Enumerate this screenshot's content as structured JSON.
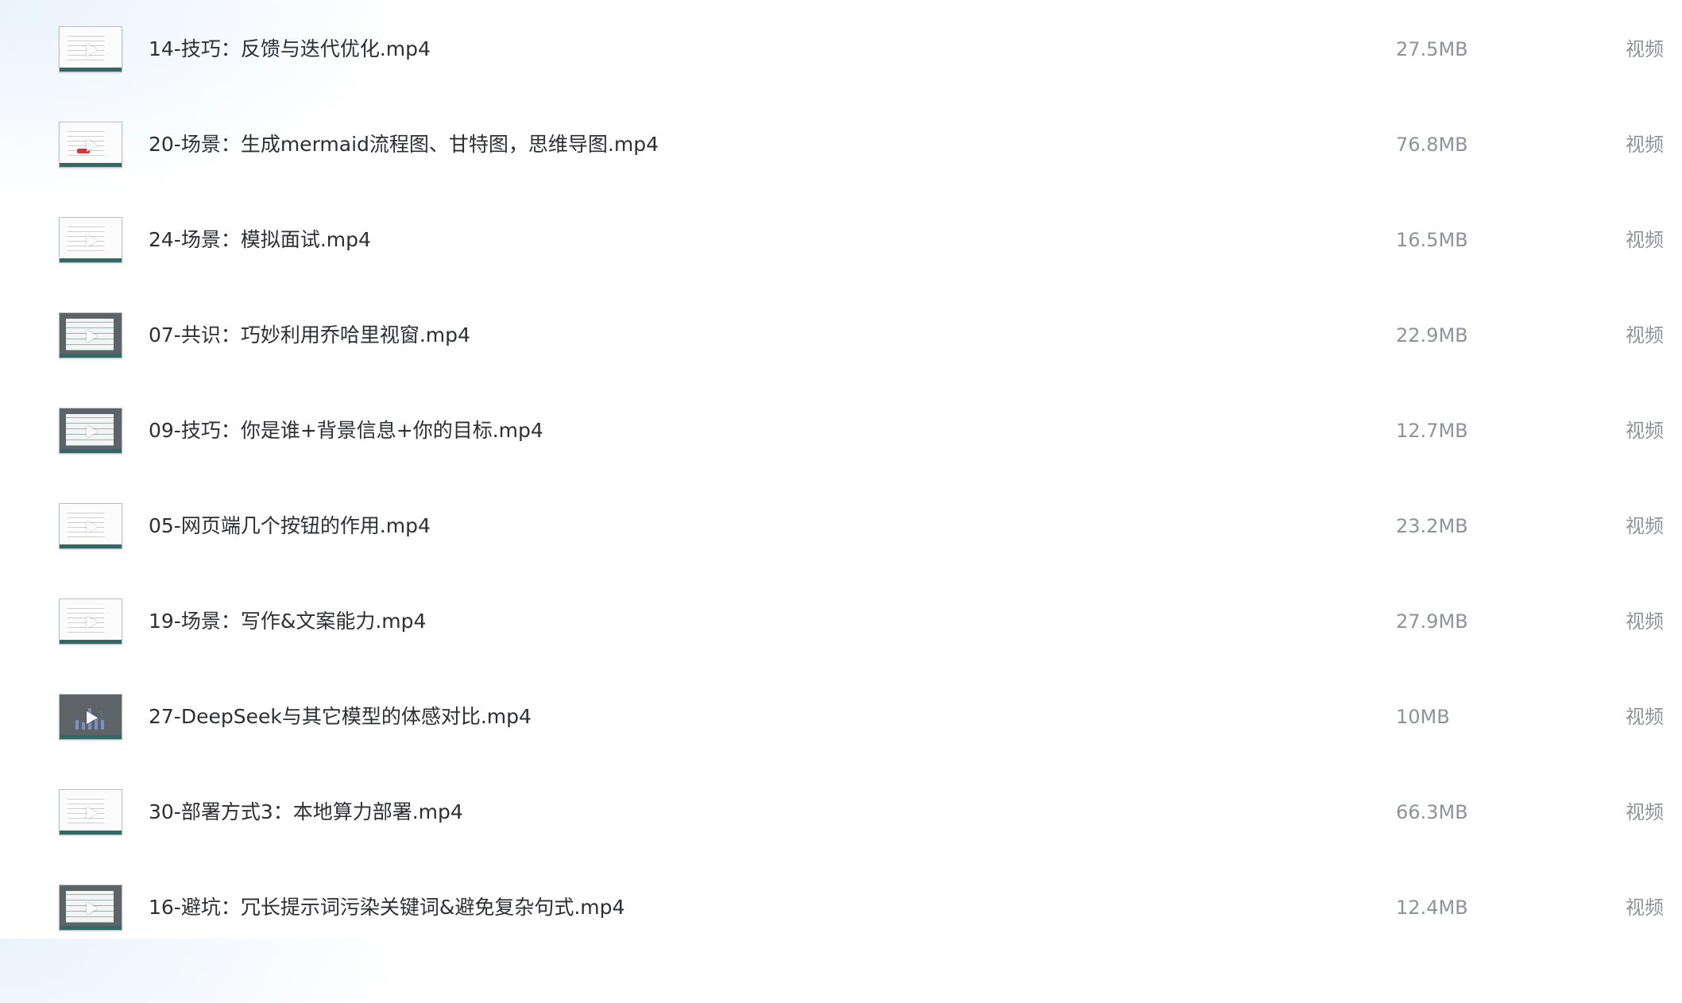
{
  "files": [
    {
      "name": "14-技巧：反馈与迭代优化.mp4",
      "size": "27.5MB",
      "type": "视频",
      "thumbnail": "document-video-thumbnail"
    },
    {
      "name": "20-场景：生成mermaid流程图、甘特图，思维导图.mp4",
      "size": "76.8MB",
      "type": "视频",
      "thumbnail": "diagram-video-thumbnail"
    },
    {
      "name": "24-场景：模拟面试.mp4",
      "size": "16.5MB",
      "type": "视频",
      "thumbnail": "document-video-thumbnail"
    },
    {
      "name": "07-共识：巧妙利用乔哈里视窗.mp4",
      "size": "22.9MB",
      "type": "视频",
      "thumbnail": "slide-video-thumbnail"
    },
    {
      "name": "09-技巧：你是谁+背景信息+你的目标.mp4",
      "size": "12.7MB",
      "type": "视频",
      "thumbnail": "slide-video-thumbnail"
    },
    {
      "name": "05-网页端几个按钮的作用.mp4",
      "size": "23.2MB",
      "type": "视频",
      "thumbnail": "document-video-thumbnail"
    },
    {
      "name": "19-场景：写作&文案能力.mp4",
      "size": "27.9MB",
      "type": "视频",
      "thumbnail": "document-video-thumbnail"
    },
    {
      "name": "27-DeepSeek与其它模型的体感对比.mp4",
      "size": "10MB",
      "type": "视频",
      "thumbnail": "chart-video-thumbnail"
    },
    {
      "name": "30-部署方式3：本地算力部署.mp4",
      "size": "66.3MB",
      "type": "视频",
      "thumbnail": "document-video-thumbnail"
    },
    {
      "name": "16-避坑：冗长提示词污染关键词&避免复杂句式.mp4",
      "size": "12.4MB",
      "type": "视频",
      "thumbnail": "slide-video-thumbnail"
    }
  ],
  "colors": {
    "name_text": "#2d2f33",
    "meta_text": "#8f9399",
    "thumb_bar": "#2f6b66"
  }
}
